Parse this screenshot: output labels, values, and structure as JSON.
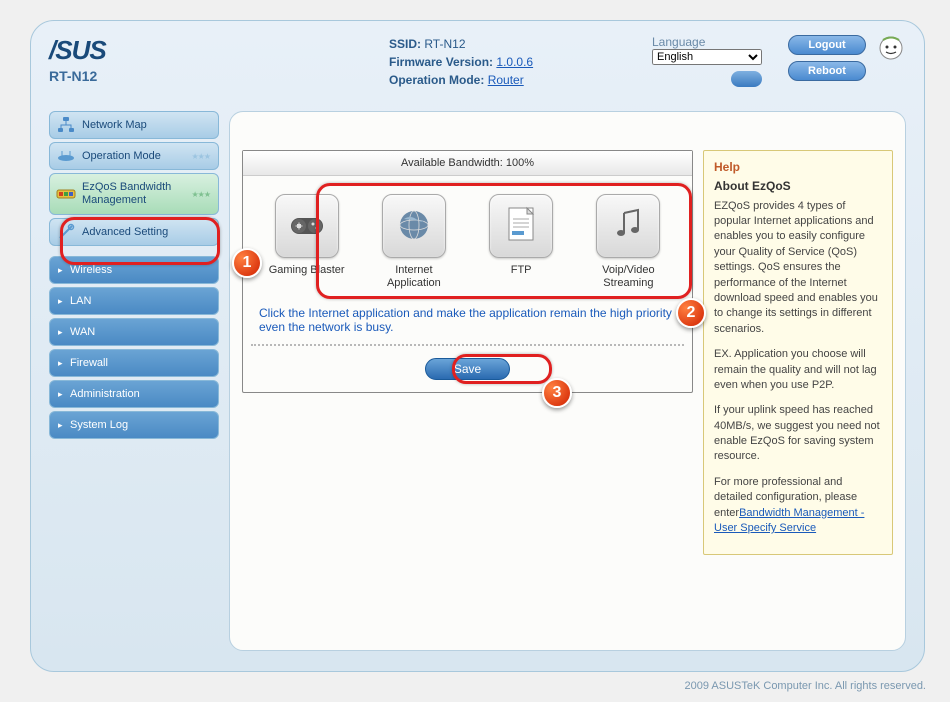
{
  "header": {
    "brand": "/SUS",
    "model": "RT-N12",
    "ssid_label": "SSID:",
    "ssid_value": "RT-N12",
    "fw_label": "Firmware Version:",
    "fw_value": "1.0.0.6",
    "op_label": "Operation Mode:",
    "op_value": "Router",
    "lang_label": "Language",
    "lang_value": "English",
    "logout": "Logout",
    "reboot": "Reboot"
  },
  "sidebar": {
    "network_map": "Network Map",
    "operation_mode": "Operation Mode",
    "ezqos": "EzQoS Bandwidth Management",
    "advanced": "Advanced Setting",
    "sub": [
      "Wireless",
      "LAN",
      "WAN",
      "Firewall",
      "Administration",
      "System Log"
    ]
  },
  "main": {
    "bw_title": "Available Bandwidth: 100%",
    "apps": [
      {
        "label": "Gaming Blaster"
      },
      {
        "label": "Internet Application"
      },
      {
        "label": "FTP"
      },
      {
        "label": "Voip/Video Streaming"
      }
    ],
    "instruction": "Click the Internet application and make the application remain the high priority even the network is busy.",
    "save": "Save"
  },
  "help": {
    "title": "Help",
    "about": "About EzQoS",
    "p1": "EZQoS provides 4 types of popular Internet applications and enables you to easily configure your Quality of Service (QoS) settings. QoS ensures the performance of the Internet download speed and enables you to change its settings in different scenarios.",
    "p2": "EX. Application you choose will remain the quality and will not lag even when you use P2P.",
    "p3": "If your uplink speed has reached 40MB/s, we suggest you need not enable EzQoS for saving system resource.",
    "p4_pre": "For more professional and detailed configuration, please enter",
    "p4_link": "Bandwidth Management - User Specify Service"
  },
  "footer": "2009 ASUSTeK Computer Inc. All rights reserved."
}
